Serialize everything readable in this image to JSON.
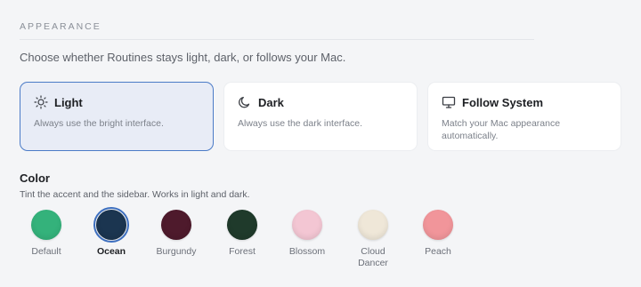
{
  "appearance": {
    "section_label": "APPEARANCE",
    "intro": "Choose whether Routines stays light, dark, or follows your Mac.",
    "modes": [
      {
        "title": "Light",
        "desc": "Always use the bright interface.",
        "icon": "sun-icon",
        "selected": true
      },
      {
        "title": "Dark",
        "desc": "Always use the dark interface.",
        "icon": "moon-icon",
        "selected": false
      },
      {
        "title": "Follow System",
        "desc": "Match your Mac appearance automatically.",
        "icon": "monitor-icon",
        "selected": false
      }
    ]
  },
  "color": {
    "title": "Color",
    "subtitle": "Tint the accent and the sidebar. Works in light and dark.",
    "swatches": [
      {
        "name": "Default",
        "color": "#34b27b",
        "selected": false
      },
      {
        "name": "Ocean",
        "color": "#1b3550",
        "selected": true
      },
      {
        "name": "Burgundy",
        "color": "#4e1a2c",
        "selected": false
      },
      {
        "name": "Forest",
        "color": "#1f3a2b",
        "selected": false
      },
      {
        "name": "Blossom",
        "color": "#f3c6d3",
        "selected": false
      },
      {
        "name": "Cloud Dancer",
        "color": "#efe7d8",
        "selected": false
      },
      {
        "name": "Peach",
        "color": "#f1959a",
        "selected": false
      }
    ]
  }
}
